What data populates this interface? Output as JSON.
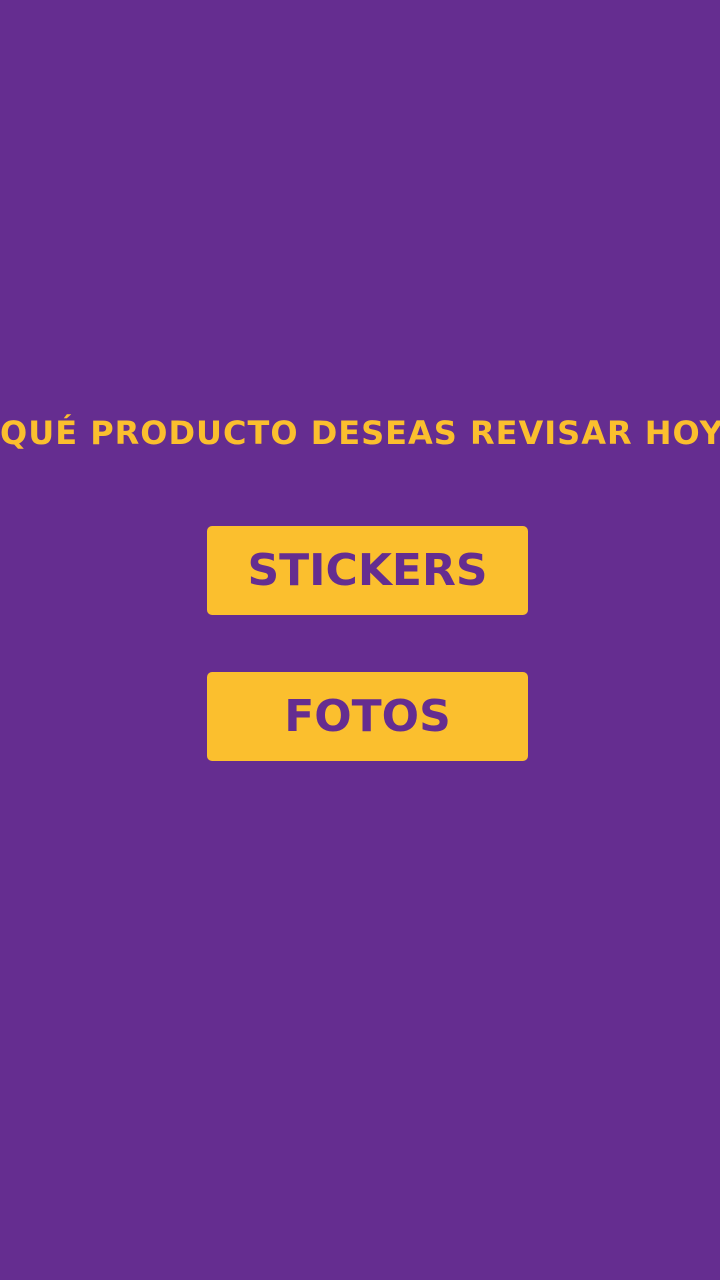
{
  "colors": {
    "background": "#652d90",
    "accent": "#fbbf2e",
    "button_text": "#652d90"
  },
  "main": {
    "title": "QUÉ PRODUCTO DESEAS REVISAR HOY",
    "buttons": [
      {
        "label": "STICKERS"
      },
      {
        "label": "FOTOS"
      }
    ]
  }
}
